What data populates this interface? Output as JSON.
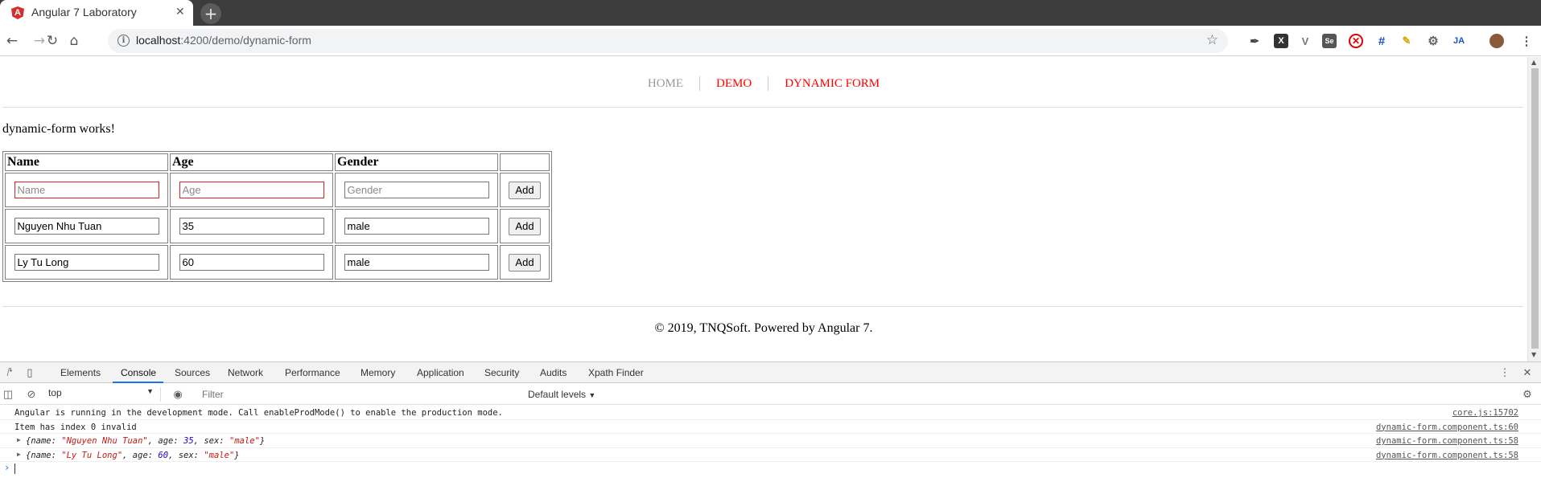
{
  "browser": {
    "tab_title": "Angular 7 Laboratory",
    "tab_favicon": "A",
    "tab_close": "✕",
    "new_tab": "+",
    "url_host": "localhost",
    "url_path": ":4200/demo/dynamic-form",
    "icons": [
      "back-icon",
      "forward-icon",
      "reload-icon",
      "home-icon",
      "info-icon",
      "star-icon"
    ],
    "extensions": [
      "pen-extension-icon",
      "x-extension-icon",
      "v-extension-icon",
      "se-extension-icon",
      "block-extension-icon",
      "hash-extension-icon",
      "brush-extension-icon",
      "gear-extension-icon",
      "ja-extension-icon",
      "avatar",
      "menu-icon"
    ]
  },
  "nav": {
    "items": [
      {
        "label": "HOME",
        "color": "#999999"
      },
      {
        "label": "DEMO",
        "color": "#ff0000"
      },
      {
        "label": "DYNAMIC FORM",
        "color": "#ff0000"
      }
    ]
  },
  "page": {
    "message": "dynamic-form works!",
    "footer": "© 2019, TNQSoft. Powered by Angular 7."
  },
  "table": {
    "headers": [
      "Name",
      "Age",
      "Gender",
      ""
    ],
    "button_label": "Add",
    "placeholders": {
      "name": "Name",
      "age": "Age",
      "gender": "Gender"
    },
    "rows": [
      {
        "name": "",
        "age": "",
        "gender": "",
        "invalid": true
      },
      {
        "name": "Nguyen Nhu Tuan",
        "age": "35",
        "gender": "male",
        "invalid": false
      },
      {
        "name": "Ly Tu Long",
        "age": "60",
        "gender": "male",
        "invalid": false
      }
    ]
  },
  "devtools": {
    "tabs": [
      "Elements",
      "Console",
      "Sources",
      "Network",
      "Performance",
      "Memory",
      "Application",
      "Security",
      "Audits",
      "Xpath Finder"
    ],
    "active_tab": "Console",
    "context": "top",
    "filter_placeholder": "Filter",
    "levels": "Default levels",
    "console": [
      {
        "message": "Angular is running in the development mode. Call enableProdMode() to enable the production mode.",
        "source": "core.js:15702"
      },
      {
        "message": "Item has index 0 invalid",
        "source": "dynamic-form.component.ts:60"
      },
      {
        "object": {
          "name": "Nguyen Nhu Tuan",
          "age": "35",
          "sex": "male"
        },
        "source": "dynamic-form.component.ts:58"
      },
      {
        "object": {
          "name": "Ly Tu Long",
          "age": "60",
          "sex": "male"
        },
        "source": "dynamic-form.component.ts:58"
      }
    ],
    "prompt": "›"
  }
}
